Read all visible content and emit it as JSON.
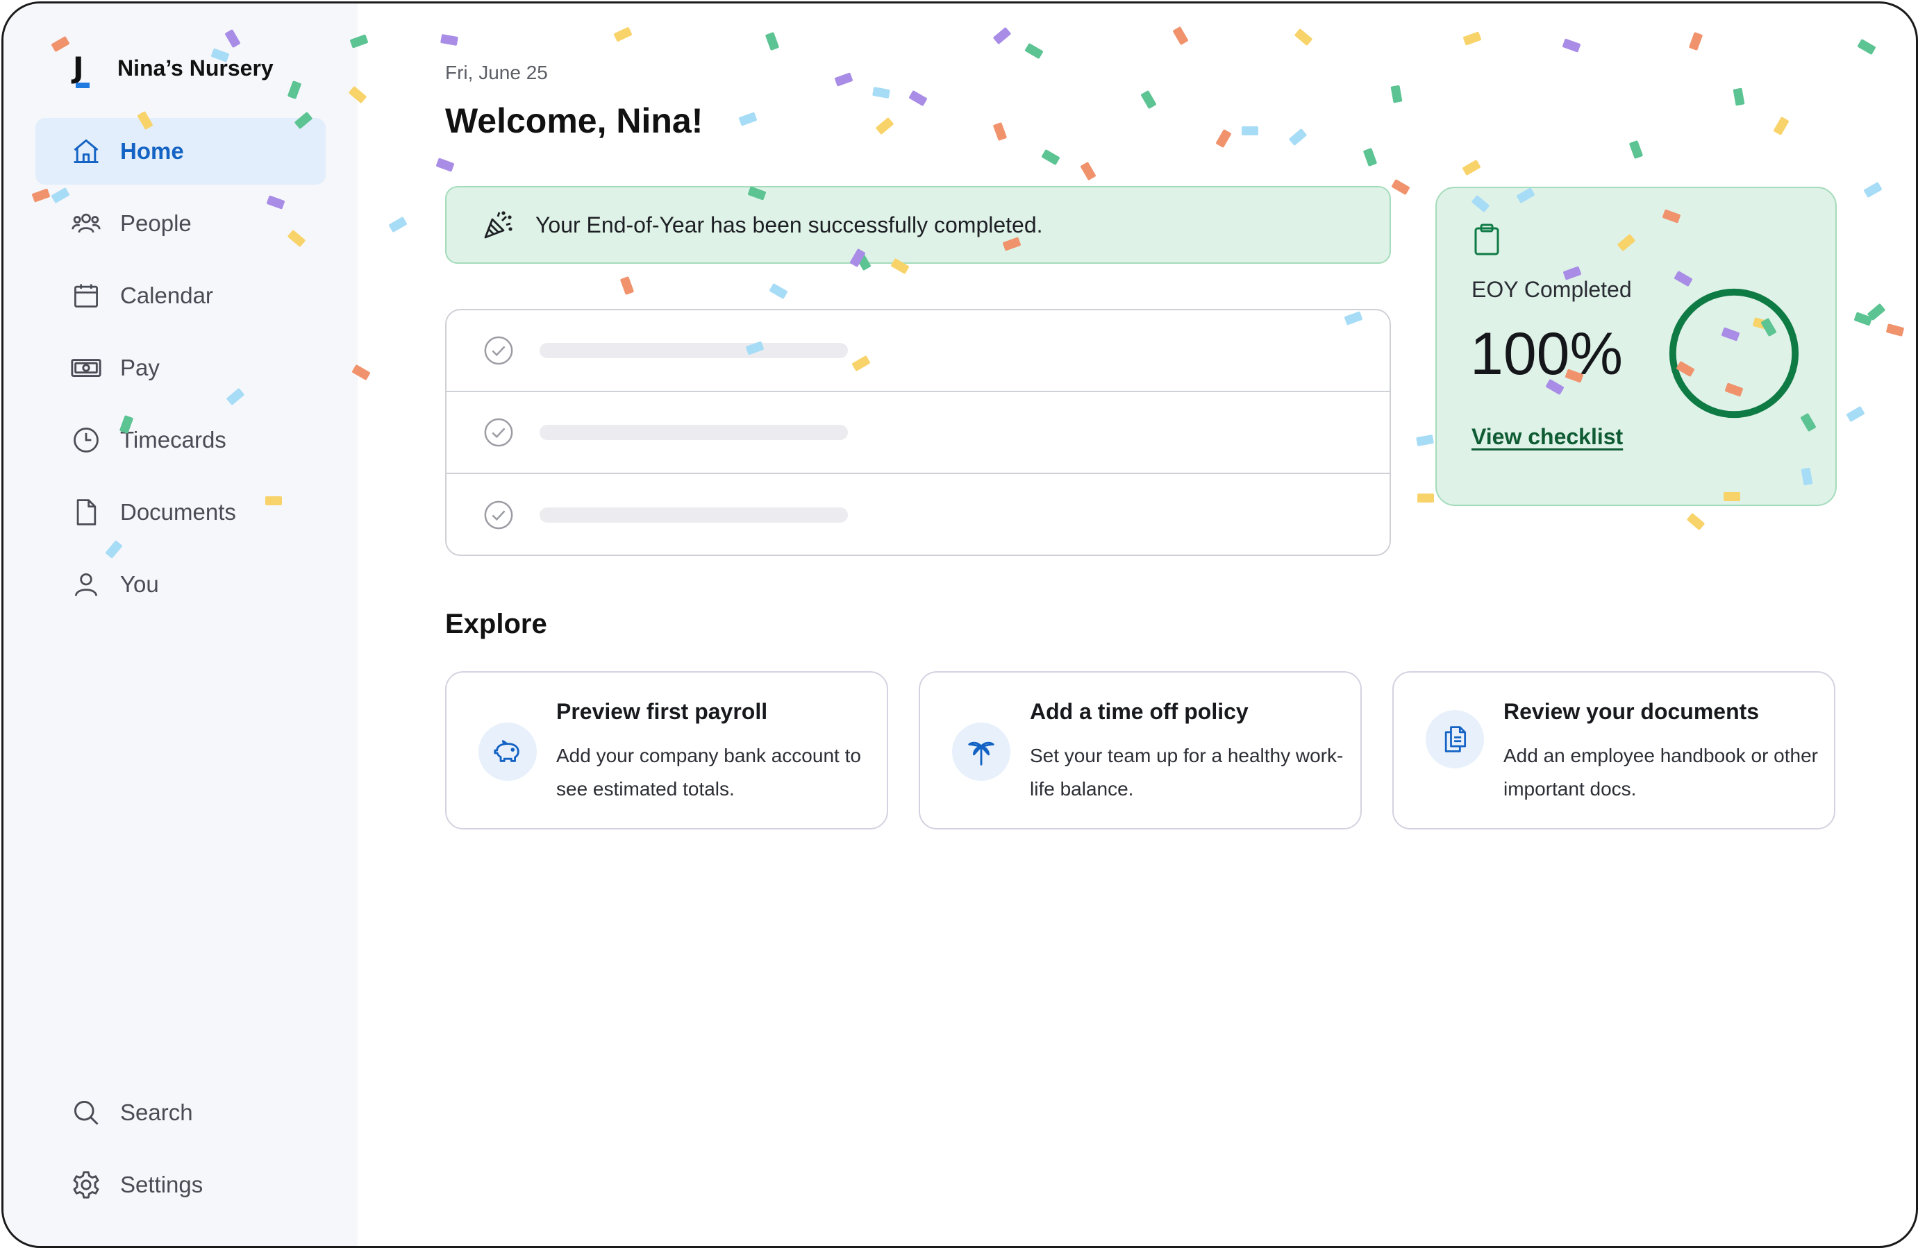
{
  "sidebar": {
    "brand": {
      "logo_letter": "J",
      "name": "Nina’s Nursery"
    },
    "items": [
      {
        "label": "Home",
        "icon": "home-icon",
        "active": true
      },
      {
        "label": "People",
        "icon": "people-icon"
      },
      {
        "label": "Calendar",
        "icon": "calendar-icon"
      },
      {
        "label": "Pay",
        "icon": "money-icon"
      },
      {
        "label": "Timecards",
        "icon": "clock-icon"
      },
      {
        "label": "Documents",
        "icon": "document-icon"
      },
      {
        "label": "You",
        "icon": "user-icon"
      }
    ],
    "bottom_items": [
      {
        "label": "Search",
        "icon": "search-icon"
      },
      {
        "label": "Settings",
        "icon": "gear-icon"
      }
    ]
  },
  "main": {
    "date": "Fri, June 25",
    "welcome": "Welcome, Nina!",
    "banner": {
      "icon": "party-popper-icon",
      "text": "Your End-of-Year has been successfully completed."
    },
    "checklist": {
      "icon": "check-circle-icon"
    },
    "eoy_card": {
      "icon": "clipboard-icon",
      "label": "EOY Completed",
      "value": "100%",
      "progress": 1.0,
      "link": "View checklist"
    },
    "explore": {
      "title": "Explore",
      "cards": [
        {
          "icon": "piggy-bank-icon",
          "title": "Preview first payroll",
          "description": "Add your company bank account to see estimated totals."
        },
        {
          "icon": "palm-tree-icon",
          "title": "Add a time off policy",
          "description": "Set your team up for a healthy work-life balance."
        },
        {
          "icon": "documents-icon",
          "title": "Review your documents",
          "description": "Add an employee handbook or other important docs."
        }
      ]
    }
  },
  "colors": {
    "accent": "#1463c4",
    "active_nav_bg": "#e2eefb",
    "success_bg": "#def2e7",
    "success_border": "#a4dcbb",
    "ring": "#0e7a44",
    "sidebar_bg": "#f6f7fb",
    "confetti": [
      "#f0936d",
      "#a88ce6",
      "#5cc392",
      "#f8d36a",
      "#a7dcf6"
    ]
  }
}
